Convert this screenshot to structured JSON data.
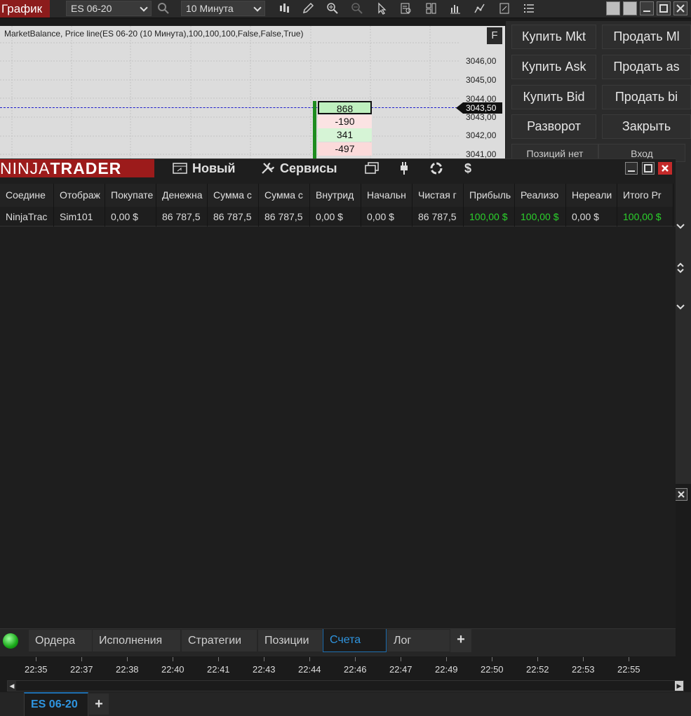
{
  "chart_window": {
    "title": "График",
    "instrument": "ES 06-20",
    "interval": "10 Минута",
    "indicator_label": "MarketBalance, Price line(ES 06-20 (10 Минута),100,100,100,False,False,True)",
    "f_button": "F",
    "price_ticks": [
      "3046,00",
      "3045,00",
      "3044,00",
      "3043,00",
      "3042,00",
      "3041,00"
    ],
    "last_price": "3043,50",
    "market_balance": [
      {
        "value": "868",
        "tone": "green"
      },
      {
        "value": "-190",
        "tone": "red"
      },
      {
        "value": "341",
        "tone": "green"
      },
      {
        "value": "-497",
        "tone": "red"
      }
    ],
    "time_ticks": [
      "22:35",
      "22:37",
      "22:38",
      "22:40",
      "22:41",
      "22:43",
      "22:44",
      "22:46",
      "22:47",
      "22:49",
      "22:50",
      "22:52",
      "22:53",
      "22:55"
    ],
    "bottom_tab": "ES 06-20",
    "bottom_add": "+"
  },
  "chart_trader": {
    "buy_mkt": "Купить Mkt",
    "sell_mkt": "Продать Ml",
    "buy_ask": "Купить Ask",
    "sell_ask": "Продать as",
    "buy_bid": "Купить Bid",
    "sell_bid": "Продать bi",
    "reverse": "Разворот",
    "close": "Закрыть",
    "position": "Позиций нет",
    "entry": "Вход"
  },
  "control_center": {
    "logo_ninja": "NINJA",
    "logo_trader": "TRADER",
    "menu_new": "Новый",
    "menu_services": "Сервисы",
    "columns": [
      "Соедине",
      "Отображ",
      "Покупате",
      "Денежна",
      "Сумма с",
      "Сумма с",
      "Внутрид",
      "Начальн",
      "Чистая г",
      "Прибыль",
      "Реализо",
      "Нереали",
      "Итого Pr"
    ],
    "row": [
      "NinjaTrac",
      "Sim101",
      "0,00 $",
      "86 787,5",
      "86 787,5",
      "86 787,5",
      "0,00 $",
      "0,00 $",
      "86 787,5",
      "100,00 $",
      "100,00 $",
      "0,00 $",
      "100,00 $"
    ],
    "tabs": [
      "Ордера",
      "Исполнения",
      "Стратегии",
      "Позиции",
      "Счета",
      "Лог"
    ],
    "active_tab": "Счета",
    "tab_add": "+",
    "colors": {
      "profit": "#2bd12b",
      "logo_bg": "#9c1b1b",
      "accent": "#2f95e0"
    }
  }
}
